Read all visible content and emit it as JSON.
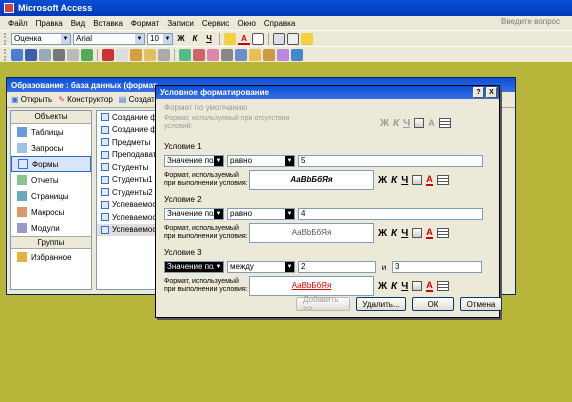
{
  "app": {
    "title": "Microsoft Access",
    "help_placeholder": "Введите вопрос"
  },
  "menu": [
    "Файл",
    "Правка",
    "Вид",
    "Вставка",
    "Формат",
    "Записи",
    "Сервис",
    "Окно",
    "Справка"
  ],
  "toolbar": {
    "object_combo": "Оценка",
    "font_combo": "Arial",
    "size_combo": "10",
    "bold": "Ж",
    "italic": "К",
    "underline": "Ч",
    "font_color_letter": "A"
  },
  "db_window": {
    "title": "Образование : база данных (формат ...",
    "toolbar": {
      "open": "Открыть",
      "designer": "Конструктор",
      "create": "Создать"
    },
    "objects_header": "Объекты",
    "objects": [
      "Таблицы",
      "Запросы",
      "Формы",
      "Отчеты",
      "Страницы",
      "Макросы",
      "Модули"
    ],
    "selected_object": "Формы",
    "groups_header": "Группы",
    "groups": [
      "Избранное"
    ],
    "items": [
      "Создание форм",
      "Создание форм",
      "Предметы",
      "Преподавател",
      "Студенты",
      "Студенты1",
      "Студенты2",
      "Успеваемост",
      "Успеваемост",
      "Успеваемост"
    ]
  },
  "dialog": {
    "title": "Условное форматирование",
    "default": {
      "label": "Формат по умолчанию",
      "format_label": "Формат, используемый при отсутствии условий:"
    },
    "conditions": [
      {
        "label": "Условие 1",
        "field": "Значение поля",
        "operator": "равно",
        "value1": "5",
        "value2": "",
        "format_label": "Формат, используемый при выполнении условия:",
        "preview": "АаВbБбЯя"
      },
      {
        "label": "Условие 2",
        "field": "Значение поля",
        "operator": "равно",
        "value1": "4",
        "value2": "",
        "format_label": "Формат, используемый при выполнении условия:",
        "preview": "АаВbБбЯя"
      },
      {
        "label": "Условие 3",
        "field": "Значение поля",
        "operator": "между",
        "value1": "2",
        "and_label": "и",
        "value2": "3",
        "format_label": "Формат, используемый при выполнении условия:",
        "preview": "АаВbБбЯя"
      }
    ],
    "tools": {
      "bold": "Ж",
      "italic": "К",
      "underline": "Ч",
      "font_color": "A"
    },
    "buttons": {
      "add": "Добавить >>",
      "delete": "Удалить...",
      "ok": "ОК",
      "cancel": "Отмена"
    },
    "title_buttons": {
      "help": "?",
      "close": "X"
    }
  },
  "colors": {
    "desktop": "#B7B53A",
    "titlebar": "#0A4FD6",
    "dialog_bg": "#ECE9D8",
    "condition1_preview": "#000000",
    "condition2_preview": "#555555",
    "condition3_preview": "#E00000"
  }
}
